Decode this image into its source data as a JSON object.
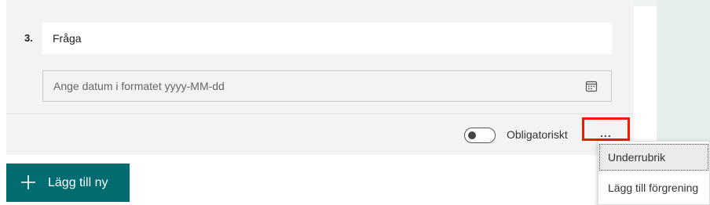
{
  "question": {
    "number": "3.",
    "title": "Fråga",
    "date_placeholder": "Ange datum i formatet yyyy-MM-dd"
  },
  "footer": {
    "required_label": "Obligatoriskt",
    "required_on": false,
    "more_label": "..."
  },
  "add_button": {
    "label": "Lägg till ny"
  },
  "more_menu": {
    "items": [
      {
        "label": "Underrubrik"
      },
      {
        "label": "Lägg till förgrening"
      }
    ]
  },
  "colors": {
    "accent": "#036c70",
    "highlight_border": "#e81e05",
    "card_bg": "#f3f3f3"
  }
}
